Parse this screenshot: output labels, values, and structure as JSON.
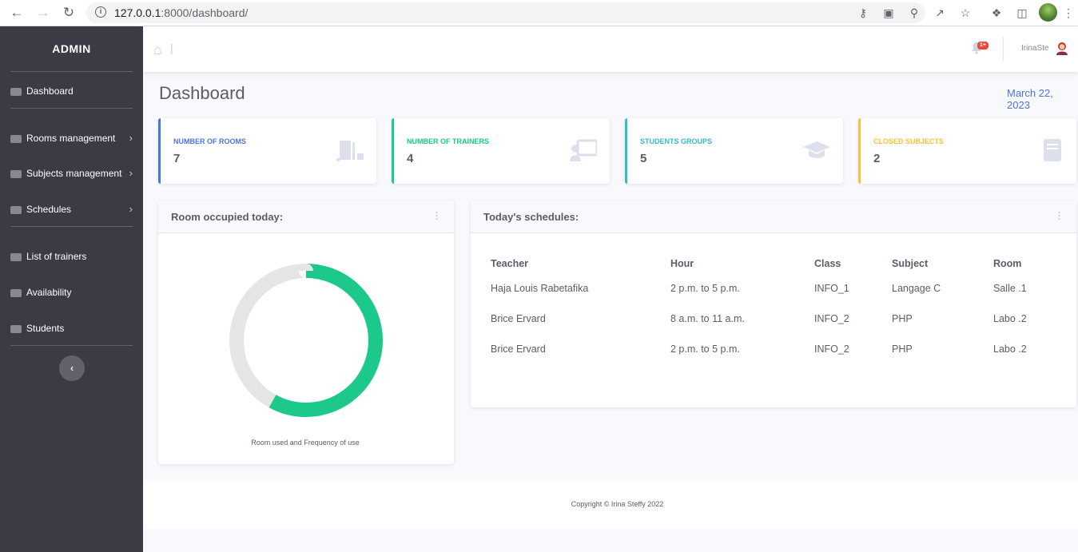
{
  "browser": {
    "url_host": "127.0.0.1",
    "url_rest": ":8000/dashboard/"
  },
  "sidebar": {
    "brand": "ADMIN",
    "items": [
      {
        "label": "Dashboard",
        "icon": "tachometer-icon",
        "has_chevron": false
      },
      {
        "label": "Rooms management",
        "icon": "door-icon",
        "has_chevron": true
      },
      {
        "label": "Subjects management",
        "icon": "book-icon",
        "has_chevron": true
      },
      {
        "label": "Schedules",
        "icon": "calendar-icon",
        "has_chevron": true
      },
      {
        "label": "List of trainers",
        "icon": "chalkboard-teacher-icon",
        "has_chevron": false
      },
      {
        "label": "Availability",
        "icon": "calendar-check-icon",
        "has_chevron": false
      },
      {
        "label": "Students",
        "icon": "graduation-cap-icon",
        "has_chevron": false
      }
    ],
    "toggle_icon": "chevron-left-icon"
  },
  "topbar": {
    "home_icon": "home-icon",
    "separator": "|",
    "notification_badge": "1+",
    "username": "IrinaSte"
  },
  "page": {
    "title": "Dashboard",
    "date": "March 22, 2023"
  },
  "cards": [
    {
      "label": "NUMBER OF ROOMS",
      "value": "7",
      "color": "#4e73df",
      "icon": "door-open-icon"
    },
    {
      "label": "NUMBER OF TRAINERS",
      "value": "4",
      "color": "#1cc88a",
      "icon": "chalkboard-teacher-icon"
    },
    {
      "label": "STUDENTS GROUPS",
      "value": "5",
      "color": "#36b9cc",
      "icon": "graduation-cap-icon"
    },
    {
      "label": "CLOSED SUBJECTS",
      "value": "2",
      "color": "#f6c23e",
      "icon": "book-icon"
    }
  ],
  "room_panel": {
    "title": "Room occupied today:",
    "caption": "Room used and Frequency of use"
  },
  "chart_data": {
    "type": "pie",
    "donut": true,
    "values": [
      58,
      42
    ],
    "colors": [
      "#1cc88a",
      "#e5e5e5"
    ],
    "title": "",
    "caption": "Room used and Frequency of use"
  },
  "schedule_panel": {
    "title": "Today's schedules:",
    "columns": [
      "Teacher",
      "Hour",
      "Class",
      "Subject",
      "Room"
    ],
    "rows": [
      [
        "Haja Louis Rabetafika",
        "2 p.m. to 5 p.m.",
        "INFO_1",
        "Langage C",
        "Salle .1"
      ],
      [
        "Brice Ervard",
        "8 a.m. to 11 a.m.",
        "INFO_2",
        "PHP",
        "Labo .2"
      ],
      [
        "Brice Ervard",
        "2 p.m. to 5 p.m.",
        "INFO_2",
        "PHP",
        "Labo .2"
      ]
    ]
  },
  "footer": {
    "copyright": "Copyright © Irina Steffy 2022"
  }
}
